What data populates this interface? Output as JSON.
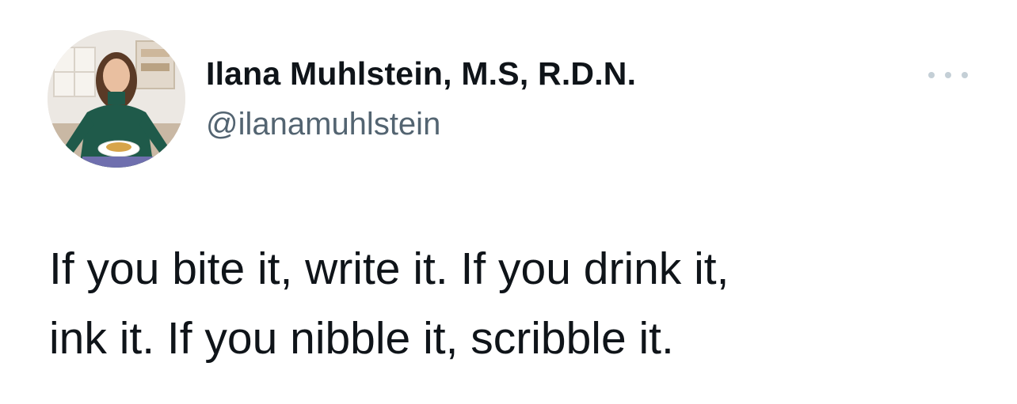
{
  "author": {
    "display_name": "Ilana Muhlstein, M.S, R.D.N.",
    "handle": "@ilanamuhlstein",
    "avatar_icon": "profile-photo"
  },
  "menu": {
    "icon": "more-horizontal-icon"
  },
  "tweet": {
    "lines": [
      "If you bite it, write it. If you drink it,",
      "ink it. If you nibble it, scribble it."
    ]
  },
  "colors": {
    "name": "#0f1419",
    "handle": "#536471",
    "more_dots": "#c4cfd6",
    "background": "#ffffff"
  }
}
